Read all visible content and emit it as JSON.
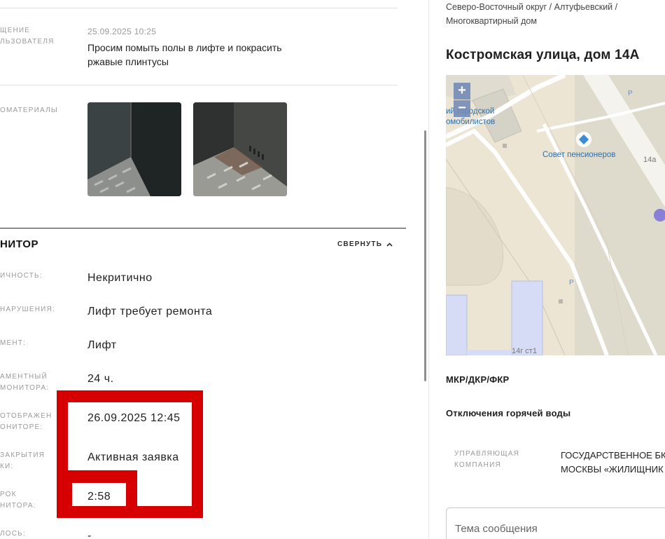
{
  "message": {
    "label": "ЩЕНИЕ\nЛЬЗОВАТЕЛЯ",
    "date": "25.09.2025 10:25",
    "text": "Просим помыть полы в лифте и покрасить ржавые плинтусы"
  },
  "photos": {
    "label": "ОМАТЕРИАЛЫ"
  },
  "monitor": {
    "title": "НИТОР",
    "collapse_label": "СВЕРНУТЬ",
    "fields": [
      {
        "label": "ИЧНОСТЬ:",
        "value": "Некритично"
      },
      {
        "label": "НАРУШЕНИЯ:",
        "value": "Лифт требует ремонта"
      },
      {
        "label": "МЕНТ:",
        "value": "Лифт"
      },
      {
        "label": "АМЕНТНЫЙ\nМОНИТОРА:",
        "value": "24 ч."
      },
      {
        "label": "ОТОБРАЖЕН\nОНИТОРЕ:",
        "value": "26.09.2025 12:45"
      },
      {
        "label": "ЗАКРЫТИЯ\nКИ:",
        "value": "Активная заявка"
      },
      {
        "label": "РОК\nНИТОРА:",
        "value": "2:58"
      },
      {
        "label": "ЛОСЬ:",
        "value": "-"
      }
    ]
  },
  "sidebar": {
    "breadcrumb": "Северо-Восточный округ / Алтуфьевский /\nМногоквартирный дом",
    "address": "Костромская улица, дом 14А",
    "map": {
      "label_council": "Совет пенсионеров",
      "label_club_line1": "ий городской",
      "label_club_line2": "омобилистов",
      "label_14a": "14а",
      "label_14g": "14г ст1",
      "parking_symbol": "P",
      "zoom_in": "+",
      "zoom_out": "−"
    },
    "heading_repairs": "МКР/ДКР/ФКР",
    "heading_hot_water": "Отключения горячей воды",
    "mgmt_label": "УПРАВЛЯЮЩАЯ\nКОМПАНИЯ",
    "mgmt_value": "ГОСУДАРСТВЕННОЕ БК\nМОСКВЫ «ЖИЛИЩНИК",
    "subject_placeholder": "Тема сообщения"
  },
  "colors": {
    "highlight_red": "#d60000",
    "map_road": "#ffffff",
    "map_ground": "#ece5d3",
    "map_building": "#dedacc",
    "map_blue_block": "#d6dcf5",
    "map_marker": "#8a7fd6"
  }
}
